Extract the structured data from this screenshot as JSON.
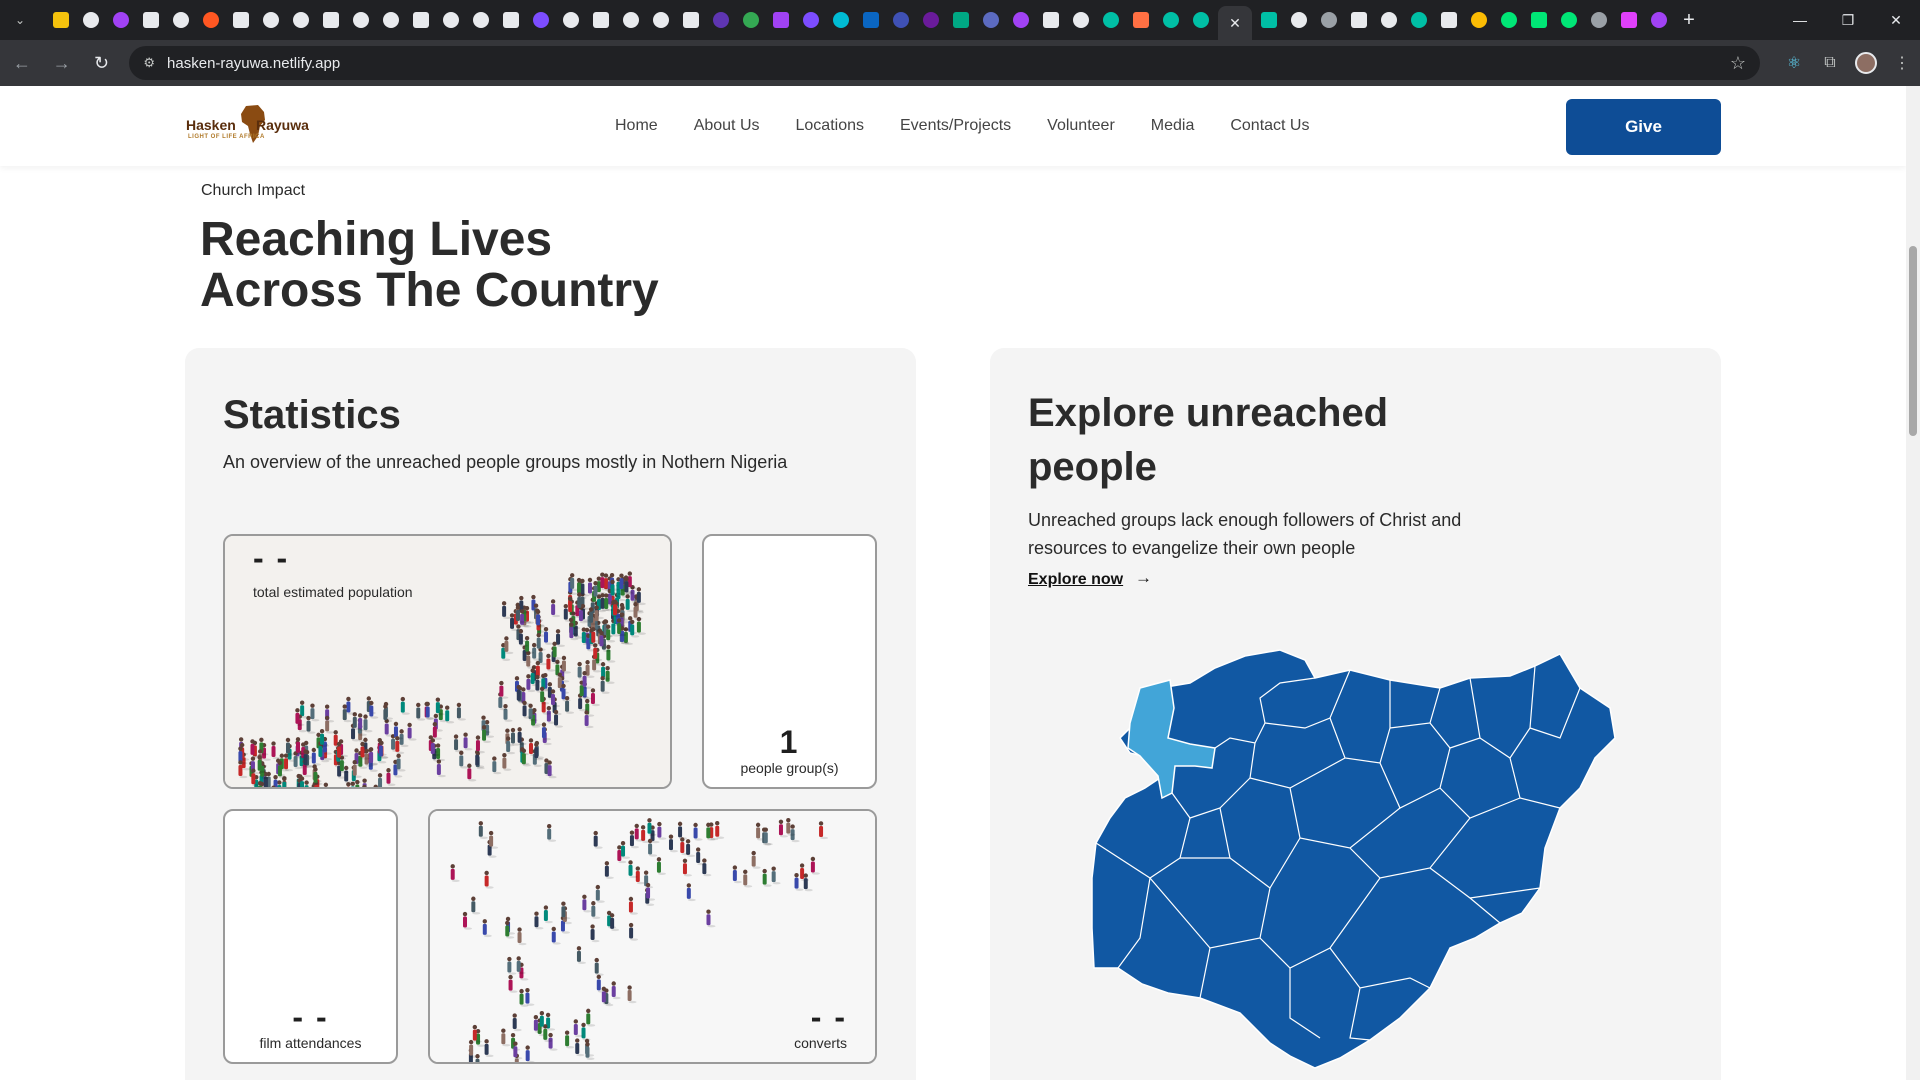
{
  "browser": {
    "url": "hasken-rayuwa.netlify.app"
  },
  "colors": {
    "brand_blue": "#0e4d96",
    "map_blue": "#1158a3",
    "map_highlight": "#42a5d8",
    "card_bg": "#f4f4f4"
  },
  "header": {
    "logo": {
      "left": "Hasken",
      "right": "Rayuwa",
      "tagline": "LIGHT OF LIFE AFRICA"
    },
    "nav": [
      "Home",
      "About Us",
      "Locations",
      "Events/Projects",
      "Volunteer",
      "Media",
      "Contact Us"
    ],
    "give_label": "Give"
  },
  "section": {
    "eyebrow": "Church Impact",
    "title_line1": "Reaching Lives",
    "title_line2": "Across The Country"
  },
  "statistics": {
    "title": "Statistics",
    "description": "An overview of the unreached people groups mostly in Nothern Nigeria",
    "tiles": {
      "population": {
        "value": "- -",
        "label": "total estimated population"
      },
      "people_groups": {
        "value": "1",
        "label": "people group(s)"
      },
      "film": {
        "value": "- -",
        "label": "film attendances"
      },
      "converts": {
        "value": "- -",
        "label": "converts"
      }
    }
  },
  "explore": {
    "title": "Explore unreached people",
    "description": "Unreached groups lack enough followers of Christ and resources to evangelize their own people",
    "link": "Explore now",
    "arrow": "→"
  }
}
